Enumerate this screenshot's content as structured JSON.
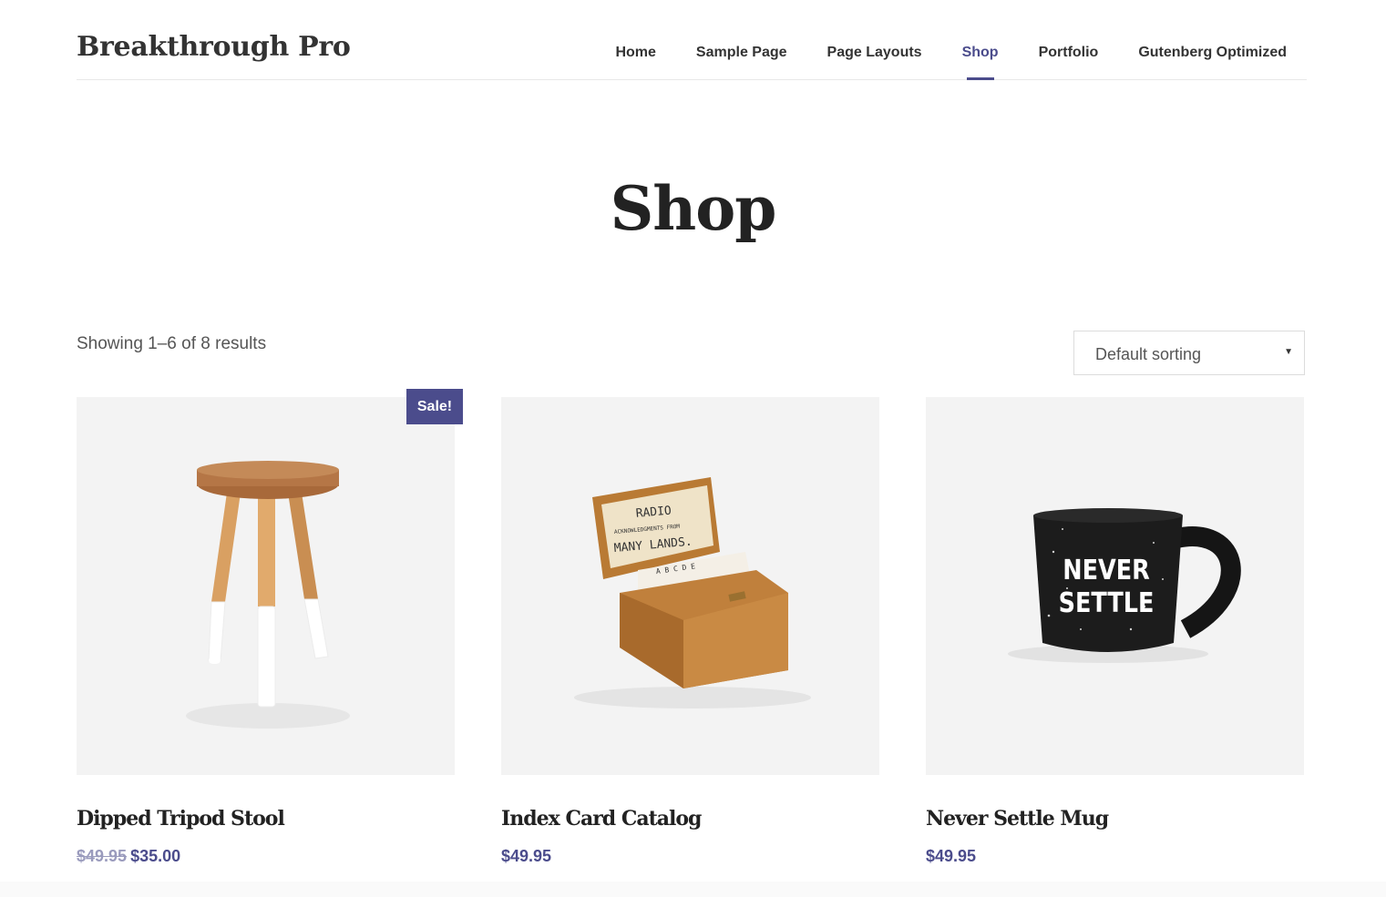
{
  "header": {
    "site_title": "Breakthrough Pro",
    "nav": [
      {
        "label": "Home"
      },
      {
        "label": "Sample Page"
      },
      {
        "label": "Page Layouts"
      },
      {
        "label": "Shop",
        "active": true
      },
      {
        "label": "Portfolio"
      },
      {
        "label": "Gutenberg Optimized"
      }
    ]
  },
  "page": {
    "title": "Shop",
    "result_count": "Showing 1–6 of 8 results",
    "sort": {
      "selected": "Default sorting"
    }
  },
  "products": [
    {
      "name": "Dipped Tripod Stool",
      "old_price": "$49.95",
      "price": "$35.00",
      "badge": "Sale!"
    },
    {
      "name": "Index Card Catalog",
      "price": "$49.95"
    },
    {
      "name": "Never Settle Mug",
      "price": "$49.95"
    }
  ],
  "catalog_box": {
    "line1": "RADIO",
    "line2": "ACKNOWLEDGMENTS FROM",
    "line3": "MANY LANDS.",
    "tabs": "A B C D E"
  },
  "mug": {
    "line1": "NEVER",
    "line2": "SETTLE"
  },
  "colors": {
    "accent": "#4b4c8c",
    "image_bg": "#f3f3f3"
  }
}
